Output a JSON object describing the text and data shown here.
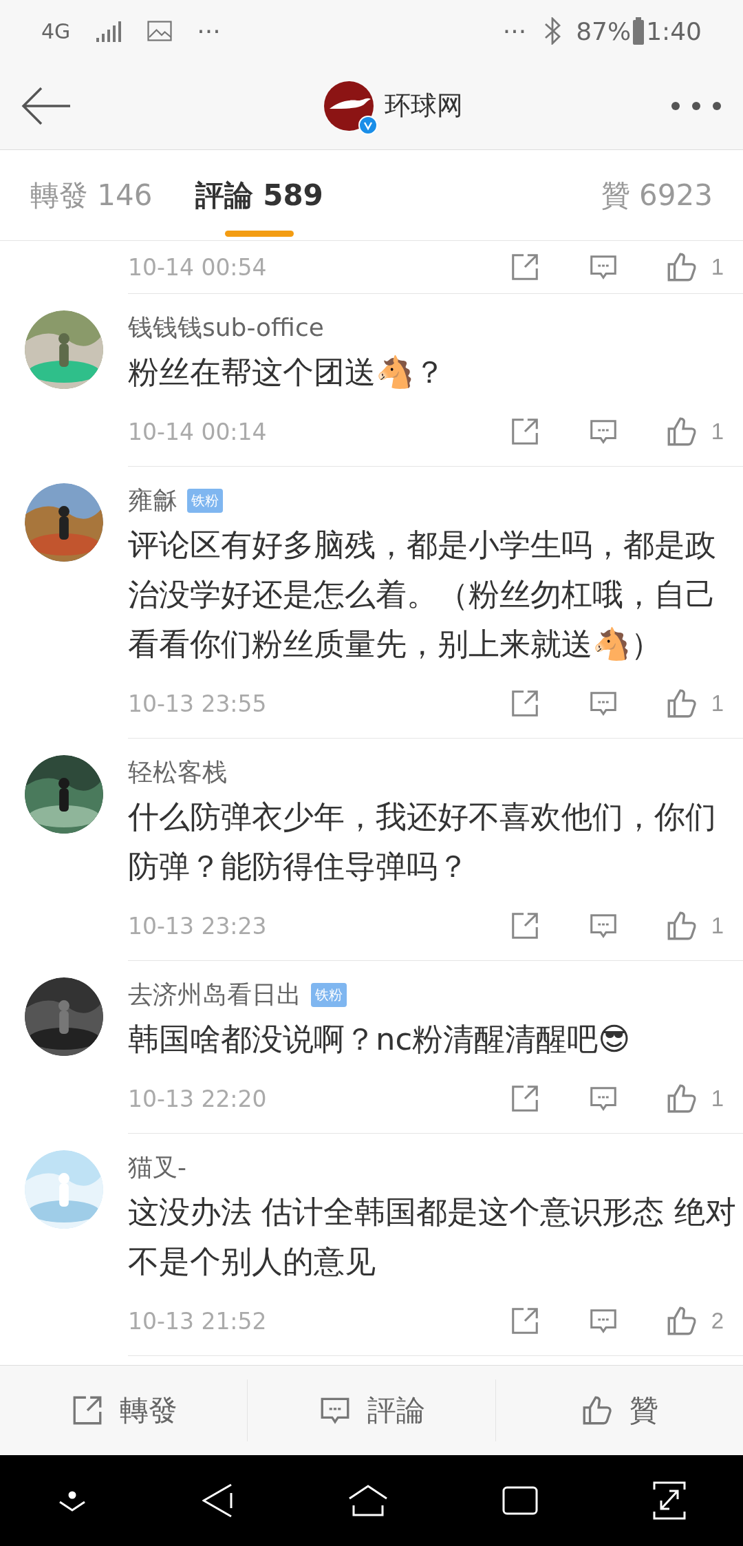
{
  "status_bar": {
    "network": "4G",
    "left_more": "···",
    "right_more": "···",
    "battery": "87%",
    "time": "1:40"
  },
  "header": {
    "title": "环球网",
    "verified": true
  },
  "tabs": [
    {
      "label": "轉發",
      "count": "146",
      "selected": false
    },
    {
      "label": "評論",
      "count": "589",
      "selected": true
    },
    {
      "label": "贊",
      "count": "6923",
      "selected": false
    }
  ],
  "comments": [
    {
      "kind": "partial",
      "time": "10-14 00:54",
      "likes": "1"
    },
    {
      "kind": "full",
      "name": "钱钱钱sub-office",
      "body": "粉丝在帮这个团送🐴？",
      "time": "10-14 00:14",
      "likes": "1"
    },
    {
      "kind": "full",
      "name": "雍龢",
      "badge": "铁粉",
      "body": "评论区有好多脑残，都是小学生吗，都是政治没学好还是怎么着。（粉丝勿杠哦，自己看看你们粉丝质量先，别上来就送🐴）",
      "time": "10-13 23:55",
      "likes": "1"
    },
    {
      "kind": "full",
      "name": "轻松客栈",
      "body": "什么防弹衣少年，我还好不喜欢他们，你们防弹？能防得住导弹吗？",
      "time": "10-13 23:23",
      "likes": "1"
    },
    {
      "kind": "full",
      "name": "去济州岛看日出",
      "badge": "铁粉",
      "body": "韩国啥都没说啊？nc粉清醒清醒吧😎",
      "time": "10-13 22:20",
      "likes": "1"
    },
    {
      "kind": "full",
      "name": "猫叉-",
      "body": "这没办法 估计全韩国都是这个意识形态 绝对不是个别人的意见",
      "time": "10-13 21:52",
      "likes": "2"
    }
  ],
  "bottom_bar": [
    {
      "kind": "share",
      "label": "轉發"
    },
    {
      "kind": "comment",
      "label": "評論"
    },
    {
      "kind": "like",
      "label": "贊"
    }
  ]
}
